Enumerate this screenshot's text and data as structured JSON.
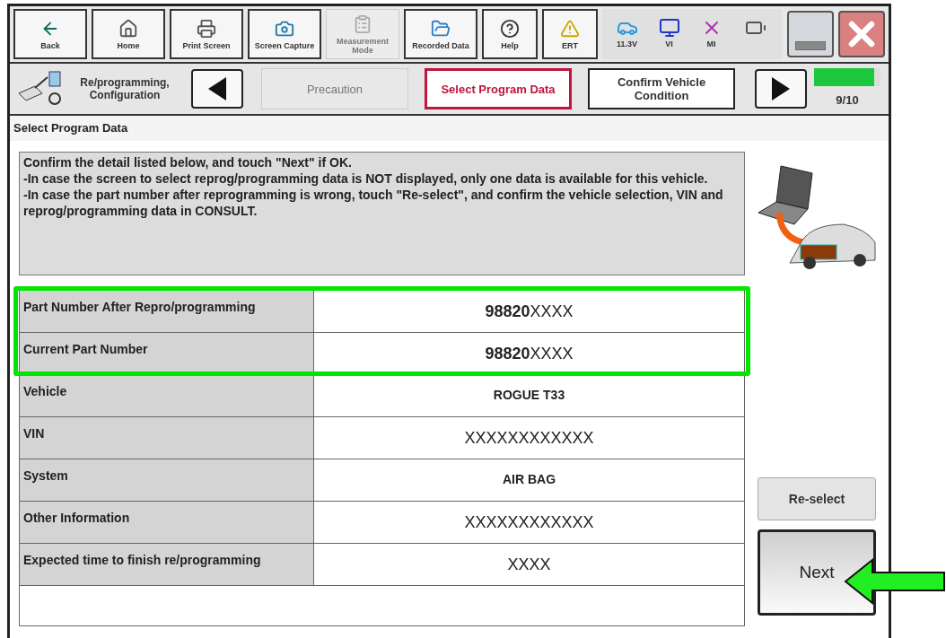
{
  "toolbar": {
    "buttons": [
      {
        "label": "Back",
        "disabled": false
      },
      {
        "label": "Home",
        "disabled": false
      },
      {
        "label": "Print Screen",
        "disabled": false
      },
      {
        "label": "Screen Capture",
        "disabled": false
      },
      {
        "label": "Measurement Mode",
        "disabled": true
      },
      {
        "label": "Recorded Data",
        "disabled": false
      },
      {
        "label": "Help",
        "disabled": false
      },
      {
        "label": "ERT",
        "disabled": false
      }
    ],
    "status": [
      {
        "label": "11.3V"
      },
      {
        "label": "VI"
      },
      {
        "label": "MI"
      }
    ]
  },
  "nav": {
    "section": "Re/programming, Configuration",
    "steps": [
      {
        "label": "Precaution",
        "selected": false,
        "done": true
      },
      {
        "label": "Select Program Data",
        "selected": true,
        "done": false
      },
      {
        "label": "Confirm Vehicle Condition",
        "selected": false,
        "done": false
      }
    ],
    "progress": {
      "level": 0.9,
      "reading": "9/10"
    }
  },
  "page_title": "Select Program Data",
  "instructions": [
    "Confirm the detail listed below, and touch \"Next\" if OK.",
    "-In case the screen to select reprog/programming data is NOT displayed, only one data is available for this vehicle.",
    "-In case the part number after reprogramming is wrong, touch \"Re-select\", and confirm the vehicle selection, VIN and reprog/programming data in CONSULT."
  ],
  "table": {
    "rows": [
      {
        "label": "Part Number After Repro/programming",
        "value": "**98820**XXXX",
        "masked": true,
        "highlighted": true
      },
      {
        "label": "Current Part Number",
        "value": "**98820**XXXX",
        "masked": true,
        "highlighted": true
      },
      {
        "label": "Vehicle",
        "value": "ROGUE T33",
        "masked": false,
        "highlighted": false
      },
      {
        "label": "VIN",
        "value": "XXXXXXXXXXXX",
        "masked": true,
        "highlighted": false
      },
      {
        "label": "System",
        "value": "AIR BAG",
        "masked": false,
        "highlighted": false
      },
      {
        "label": "Other Information",
        "value": "XXXXXXXXXXXX",
        "masked": true,
        "highlighted": false
      },
      {
        "label": "Expected time to finish re/programming",
        "value": "XXXX",
        "masked": true,
        "highlighted": false
      }
    ]
  },
  "buttons": [
    {
      "label": "Re-select",
      "kind": "secondary"
    },
    {
      "label": "Next",
      "kind": "primary"
    }
  ]
}
